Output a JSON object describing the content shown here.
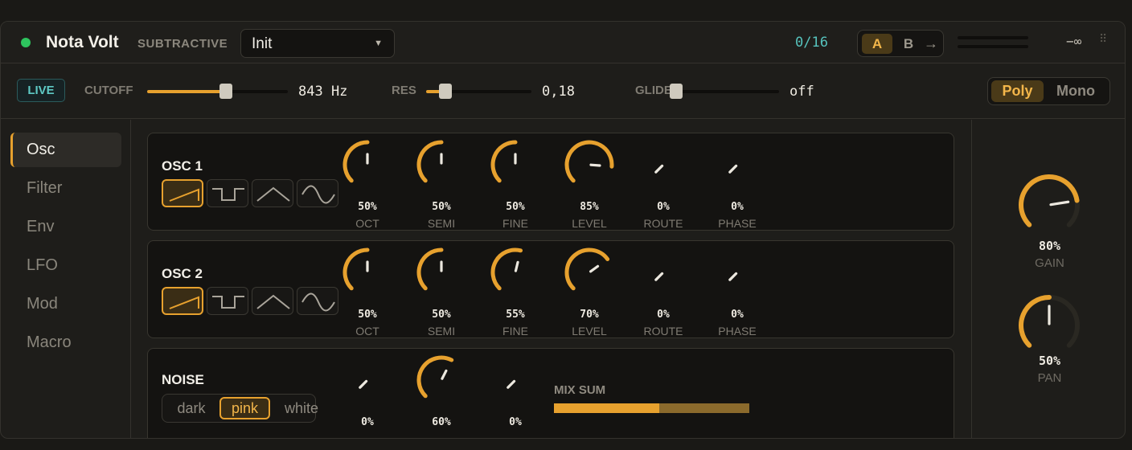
{
  "header": {
    "title": "Nota Volt",
    "subtitle": "SUBTRACTIVE",
    "preset": "Init",
    "voice_count": "0/16",
    "ab": {
      "a": "A",
      "b": "B",
      "copy": "→"
    },
    "peak": "−∞"
  },
  "globals": {
    "live": "LIVE",
    "cutoff": {
      "label": "CUTOFF",
      "value": "843 Hz",
      "level": 0.56
    },
    "res": {
      "label": "RES",
      "value": "0,18",
      "level": 0.18
    },
    "glide": {
      "label": "GLIDE",
      "value": "off",
      "level": 0
    },
    "voice_mode": {
      "poly": "Poly",
      "mono": "Mono",
      "selected": "Poly"
    }
  },
  "sidebar": {
    "items": [
      {
        "label": "Osc",
        "active": true
      },
      {
        "label": "Filter",
        "active": false
      },
      {
        "label": "Env",
        "active": false
      },
      {
        "label": "LFO",
        "active": false
      },
      {
        "label": "Mod",
        "active": false
      },
      {
        "label": "Macro",
        "active": false
      }
    ]
  },
  "osc1": {
    "title": "OSC 1",
    "waves": [
      "saw",
      "square",
      "triangle",
      "sine"
    ],
    "selected_wave": "saw",
    "knobs": [
      {
        "label": "OCT",
        "value": "50%",
        "level": 0.5
      },
      {
        "label": "SEMI",
        "value": "50%",
        "level": 0.5
      },
      {
        "label": "FINE",
        "value": "50%",
        "level": 0.5
      },
      {
        "label": "LEVEL",
        "value": "85%",
        "level": 0.85
      },
      {
        "label": "ROUTE",
        "value": "0%",
        "level": 0
      },
      {
        "label": "PHASE",
        "value": "0%",
        "level": 0
      }
    ]
  },
  "osc2": {
    "title": "OSC 2",
    "waves": [
      "saw",
      "square",
      "triangle",
      "sine"
    ],
    "selected_wave": "saw",
    "knobs": [
      {
        "label": "OCT",
        "value": "50%",
        "level": 0.5
      },
      {
        "label": "SEMI",
        "value": "50%",
        "level": 0.5
      },
      {
        "label": "FINE",
        "value": "55%",
        "level": 0.55
      },
      {
        "label": "LEVEL",
        "value": "70%",
        "level": 0.7
      },
      {
        "label": "ROUTE",
        "value": "0%",
        "level": 0
      },
      {
        "label": "PHASE",
        "value": "0%",
        "level": 0
      }
    ]
  },
  "noise": {
    "title": "NOISE",
    "colors": [
      "dark",
      "pink",
      "white"
    ],
    "selected": "pink",
    "knobs": [
      {
        "value": "0%",
        "level": 0
      },
      {
        "value": "60%",
        "level": 0.6
      },
      {
        "value": "0%",
        "level": 0
      }
    ],
    "mix": {
      "label": "MIX SUM",
      "segments": [
        0.54,
        0.46
      ]
    }
  },
  "output": {
    "gain": {
      "label": "GAIN",
      "value": "80%",
      "level": 0.8
    },
    "pan": {
      "label": "PAN",
      "value": "50%",
      "level": 0.5
    }
  },
  "colors": {
    "accent": "#e7a12e",
    "teal": "#56c3bd",
    "live_green": "#2ec45e"
  }
}
